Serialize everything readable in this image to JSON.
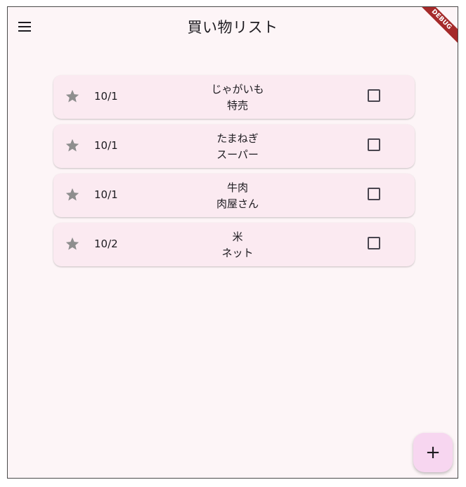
{
  "app": {
    "title": "買い物リスト",
    "debug_banner": "DEBUG"
  },
  "items": [
    {
      "date": "10/1",
      "name": "じゃがいも",
      "place": "特売",
      "starred": false,
      "checked": false
    },
    {
      "date": "10/1",
      "name": "たまねぎ",
      "place": "スーパー",
      "starred": false,
      "checked": false
    },
    {
      "date": "10/1",
      "name": "牛肉",
      "place": "肉屋さん",
      "starred": false,
      "checked": false
    },
    {
      "date": "10/2",
      "name": "米",
      "place": "ネット",
      "starred": false,
      "checked": false
    }
  ],
  "fab": {
    "label": "+"
  },
  "icons": {
    "menu": "menu-icon",
    "star": "star-icon",
    "checkbox": "checkbox-icon"
  },
  "colors": {
    "background": "#fdf5f7",
    "card": "#fbeaf1",
    "fab": "#f7d6f0",
    "star": "#8e8e8e",
    "debug": "#a52a2a"
  }
}
